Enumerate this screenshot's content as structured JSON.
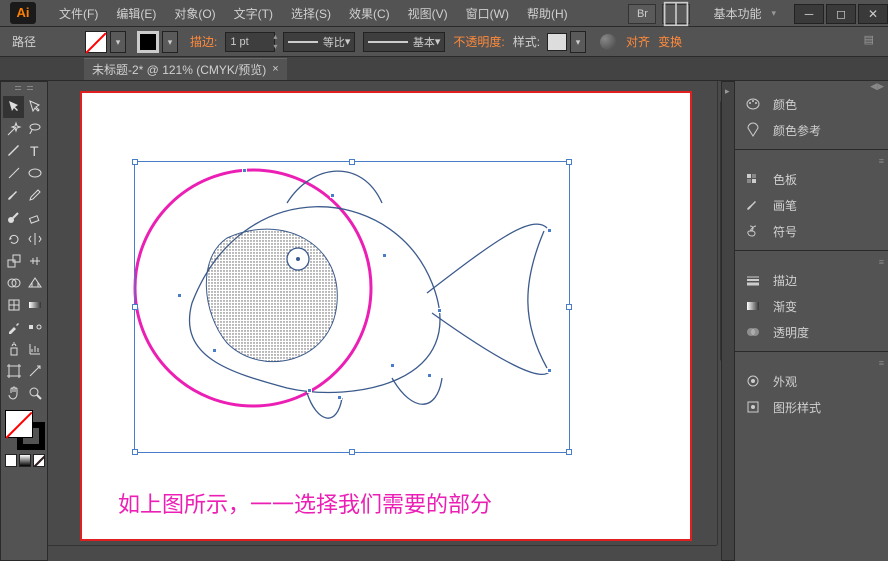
{
  "menus": [
    "文件(F)",
    "编辑(E)",
    "对象(O)",
    "文字(T)",
    "选择(S)",
    "效果(C)",
    "视图(V)",
    "窗口(W)",
    "帮助(H)"
  ],
  "workspace": "基本功能",
  "optbar": {
    "path": "路径",
    "stroke": "描边:",
    "pt": "1 pt",
    "profile1": "等比",
    "profile2": "基本",
    "opacity": "不透明度:",
    "style": "样式:",
    "align": "对齐",
    "transform": "变换"
  },
  "tab": {
    "title": "未标题-2* @ 121% (CMYK/预览)"
  },
  "caption": "如上图所示，一一选择我们需要的部分",
  "panels": {
    "g1": [
      "颜色",
      "颜色参考"
    ],
    "g2": [
      "色板",
      "画笔",
      "符号"
    ],
    "g3": [
      "描边",
      "渐变",
      "透明度"
    ],
    "g4": [
      "外观",
      "图形样式"
    ]
  }
}
